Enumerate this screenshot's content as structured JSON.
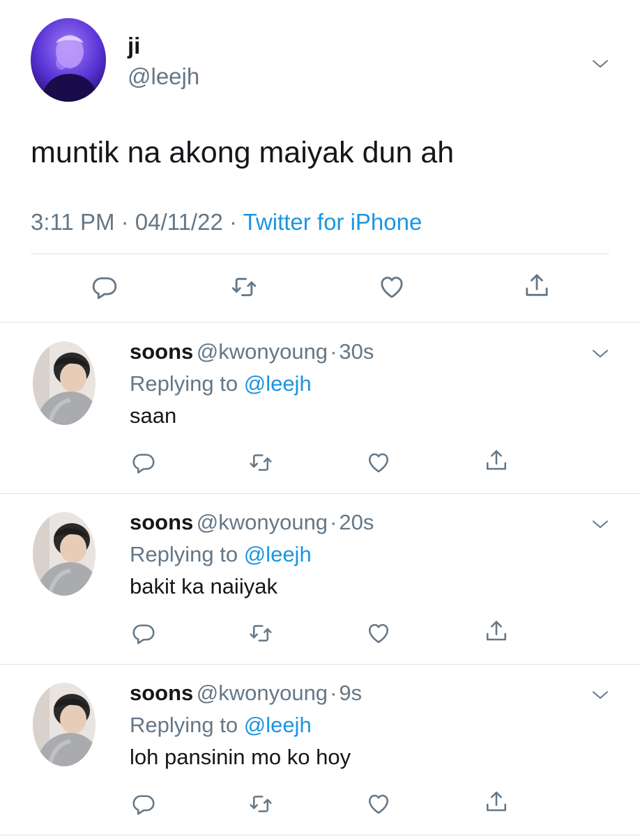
{
  "main_tweet": {
    "name": "ji",
    "handle": "@leejh",
    "text": "muntik na akong maiyak dun ah",
    "time": "3:11 PM",
    "date": "04/11/22",
    "source": "Twitter for iPhone",
    "separator": "·"
  },
  "replies": [
    {
      "name": "soons",
      "handle": "@kwonyoung",
      "time": "30s",
      "replying_prefix": "Replying to",
      "replying_to": "@leejh",
      "text": "saan"
    },
    {
      "name": "soons",
      "handle": "@kwonyoung",
      "time": "20s",
      "replying_prefix": "Replying to",
      "replying_to": "@leejh",
      "text": "bakit ka naiiyak"
    },
    {
      "name": "soons",
      "handle": "@kwonyoung",
      "time": "9s",
      "replying_prefix": "Replying to",
      "replying_to": "@leejh",
      "text": "loh pansinin mo ko hoy"
    }
  ],
  "colors": {
    "accent": "#1b95e0",
    "muted": "#657786",
    "text": "#14171a",
    "divider": "#dfe3e8"
  }
}
